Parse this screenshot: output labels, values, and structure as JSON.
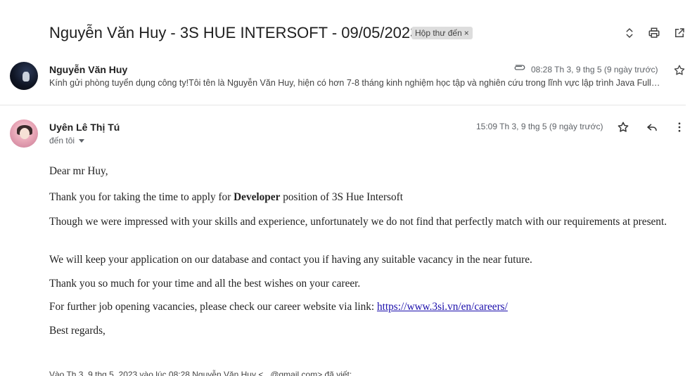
{
  "email": {
    "subject": "Nguyễn Văn Huy - 3S HUE INTERSOFT - 09/05/2023",
    "label": "Hộp thư đến",
    "label_close": "×"
  },
  "toolbar": {
    "icons": [
      "expand-collapse-icon",
      "print-icon",
      "open-new-window-icon"
    ]
  },
  "messages": [
    {
      "sender": "Nguyễn Văn Huy",
      "snippet": "Kính gửi phòng tuyển dụng công ty!Tôi tên là Nguyễn Văn Huy, hiện có hơn 7-8 tháng kinh nghiệm học tập và nghiên cứu trong lĩnh vực lập trình Java Full…",
      "time": "08:28 Th 3, 9 thg 5 (9 ngày trước)",
      "has_attachment": true
    },
    {
      "sender": "Uyên Lê Thị Tú",
      "recipient_label": "đến tôi",
      "time": "15:09 Th 3, 9 thg 5 (9 ngày trước)",
      "body": {
        "greeting": "Dear mr Huy,",
        "p1_before": "Thank you for taking the time to apply for ",
        "p1_bold": "Developer",
        "p1_after": " position of 3S Hue Intersoft",
        "p2": "Though we were impressed with your skills and experience, unfortunately we do not find that perfectly match with our requirements at present.",
        "p3": "We will keep your application on our database and contact you if having any suitable vacancy in the near future.",
        "p4": "Thank you so much for your time and all the best wishes on your career.",
        "p5_before": "For further job opening vacancies, please check our career website via link: ",
        "p5_link": "https://www.3si.vn/en/careers/",
        "closing": "Best regards,"
      }
    }
  ],
  "footer_partial": "Vào Th 3, 9 thg 5, 2023 vào lúc 08:28 Nguyễn Văn Huy <...@gmail.com> đã viết:"
}
